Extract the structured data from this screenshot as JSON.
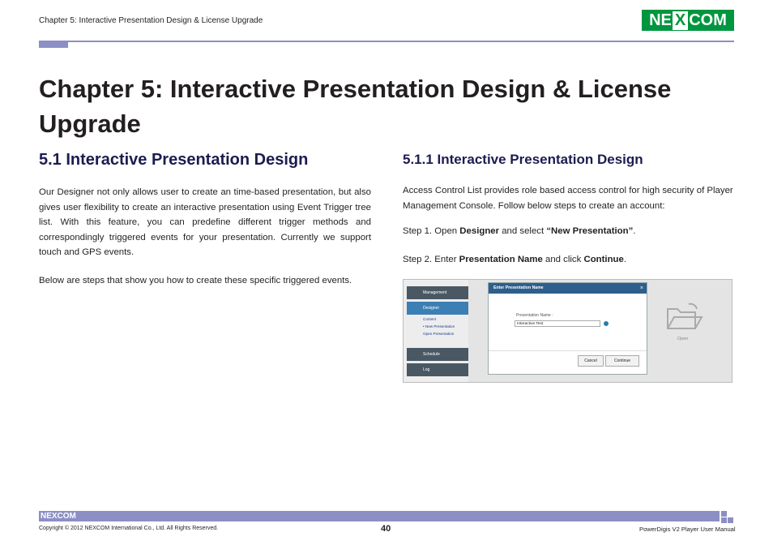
{
  "header": {
    "chapter_text": "Chapter 5: Interactive Presentation Design & License Upgrade",
    "logo": {
      "pre": "NE",
      "x": "X",
      "post": "COM"
    }
  },
  "chapter_title": "Chapter 5: Interactive Presentation Design & License Upgrade",
  "section": {
    "h2": "5.1 Interactive Presentation Design",
    "p1": "Our Designer not only allows user to create an time-based presentation, but also gives user flexibility to create an interactive presentation using Event Trigger tree list. With this feature, you can predefine different trigger methods and correspondingly triggered events for your presentation. Currently we support touch and GPS events.",
    "p2": "Below are steps that show you how to create these specific triggered events."
  },
  "subsection": {
    "h3": "5.1.1 Interactive Presentation Design",
    "p1": "Access Control List provides role based access control for high security of Player Management Console. Follow below steps to create an account:",
    "step1": {
      "prefix": "Step 1. Open ",
      "bold1": "Designer",
      "middle": " and select ",
      "bold2": "“New Presentation”",
      "suffix": "."
    },
    "step2": {
      "prefix": "Step 2. Enter ",
      "bold1": "Presentation Name",
      "middle": " and click ",
      "bold2": "Continue",
      "suffix": "."
    }
  },
  "screenshot": {
    "nav": {
      "management": "Management",
      "designer": "Designer",
      "schedule": "Schedule",
      "log": "Log"
    },
    "designer_sub": [
      "Content",
      "• New Presentation",
      "Open Presentation"
    ],
    "dialog": {
      "title": "Enter Presentation Name",
      "close": "×",
      "label": "Presentation Name :",
      "value": "Interactive Test",
      "cancel": "Cancel",
      "continue": "Continue"
    },
    "open_label": "Open"
  },
  "footer": {
    "logo": "NEXCOM",
    "copyright": "Copyright © 2012 NEXCOM International Co., Ltd. All Rights Reserved.",
    "page": "40",
    "manual": "PowerDigis V2 Player User Manual"
  }
}
